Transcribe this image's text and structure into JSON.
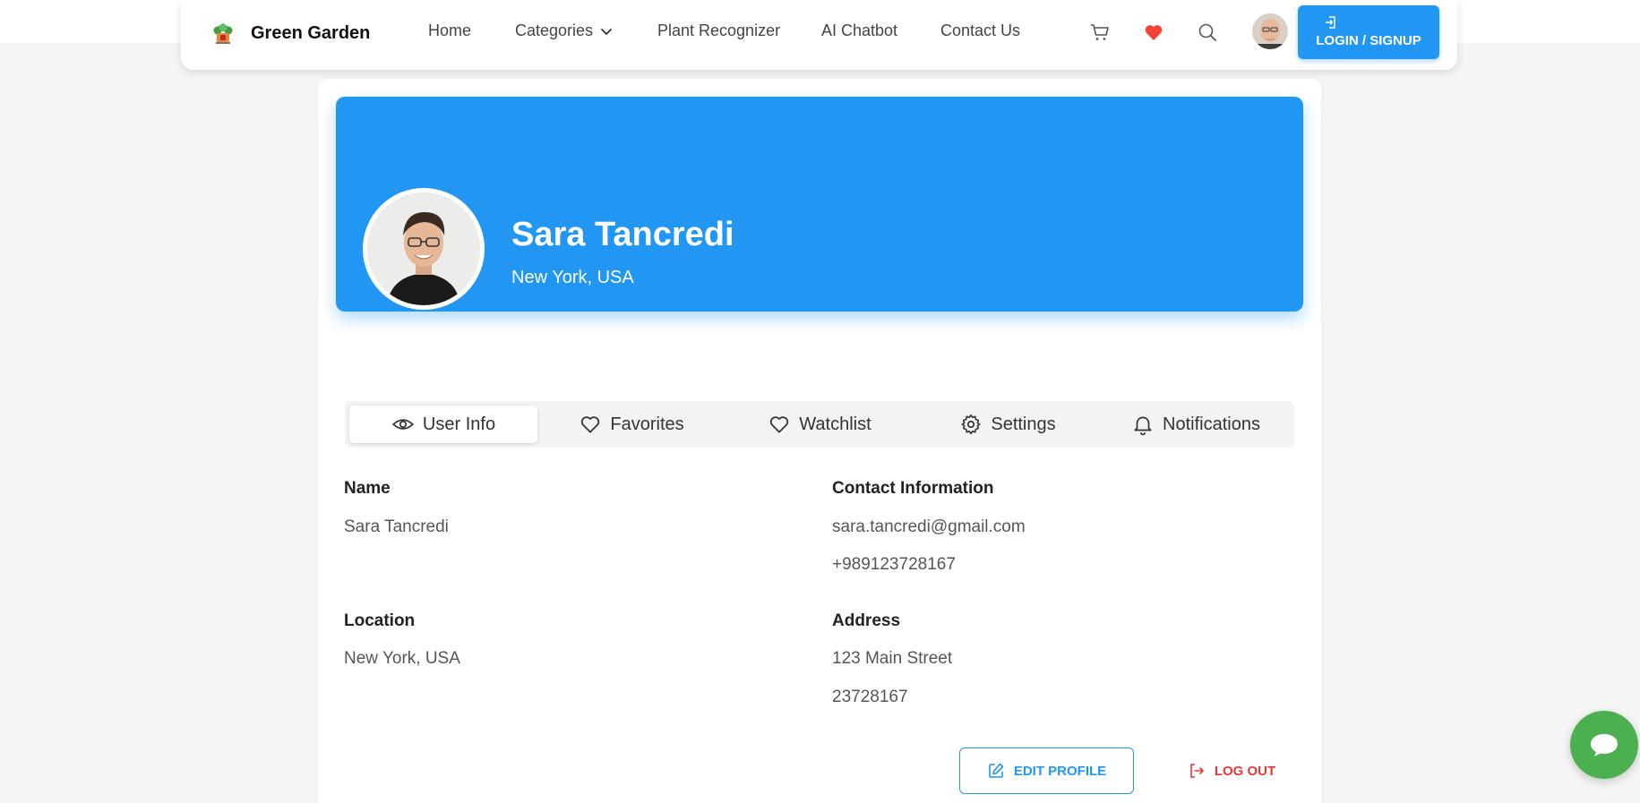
{
  "header": {
    "brand": "Green Garden",
    "nav": [
      {
        "label": "Home"
      },
      {
        "label": "Categories"
      },
      {
        "label": "Plant Recognizer"
      },
      {
        "label": "AI Chatbot"
      },
      {
        "label": "Contact Us"
      }
    ],
    "icons": [
      "cart-icon",
      "heart-icon",
      "search-icon"
    ],
    "login_label": "LOGIN / SIGNUP"
  },
  "profile": {
    "name": "Sara Tancredi",
    "location": "New York, USA"
  },
  "tabs": [
    {
      "label": "User Info",
      "icon": "eye-icon",
      "active": true
    },
    {
      "label": "Favorites",
      "icon": "heart-outline-icon"
    },
    {
      "label": "Watchlist",
      "icon": "heart-outline-icon"
    },
    {
      "label": "Settings",
      "icon": "gear-icon"
    },
    {
      "label": "Notifications",
      "icon": "bell-icon"
    }
  ],
  "info": {
    "name_label": "Name",
    "name_value": "Sara Tancredi",
    "contact_label": "Contact Information",
    "email": "sara.tancredi@gmail.com",
    "phone": "+989123728167",
    "location_label": "Location",
    "location_value": "New York, USA",
    "address_label": "Address",
    "address_line1": "123 Main Street",
    "address_line2": "23728167"
  },
  "actions": {
    "edit_label": "EDIT PROFILE",
    "logout_label": "LOG OUT"
  },
  "colors": {
    "primary": "#2196f3",
    "danger": "#e53935",
    "heart": "#f44336",
    "chat": "#4caf50"
  }
}
